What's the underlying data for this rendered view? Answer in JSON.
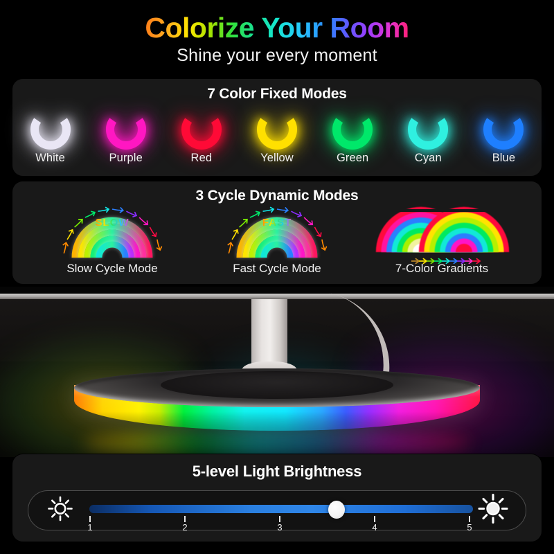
{
  "header": {
    "title": "Colorize Your Room",
    "subtitle": "Shine your every moment"
  },
  "fixed_modes": {
    "heading": "7 Color Fixed Modes",
    "items": [
      {
        "label": "White",
        "color": "#e9e6f5"
      },
      {
        "label": "Purple",
        "color": "#ff17c2"
      },
      {
        "label": "Red",
        "color": "#ff0a36"
      },
      {
        "label": "Yellow",
        "color": "#ffe000"
      },
      {
        "label": "Green",
        "color": "#00e86a"
      },
      {
        "label": "Cyan",
        "color": "#2ff0e0"
      },
      {
        "label": "Blue",
        "color": "#1e7fff"
      }
    ]
  },
  "cycle_modes": {
    "heading": "3 Cycle Dynamic Modes",
    "items": [
      {
        "label": "Slow Cycle Mode",
        "badge": "SLOW",
        "figure": "cycle-arc"
      },
      {
        "label": "Fast Cycle Mode",
        "badge": "FAST",
        "figure": "cycle-arc"
      },
      {
        "label": "7-Color Gradients",
        "badge": "",
        "figure": "gradient-arcs"
      }
    ]
  },
  "product_photo": {
    "alt": "RGB desk lamp base glowing with rainbow gradient",
    "base_gradient": [
      "#ff7b00",
      "#fff200",
      "#00f03c",
      "#12f2ee",
      "#2aa8ff",
      "#9a2dff",
      "#f21ee0",
      "#ff1040"
    ]
  },
  "brightness": {
    "heading": "5-level Light Brightness",
    "icon_low": "sun-small-icon",
    "icon_high": "sun-large-icon",
    "ticks": [
      "1",
      "2",
      "3",
      "4",
      "5"
    ],
    "current_level": 3.6,
    "track_color": "#2a7fe0",
    "thumb_color": "#ffffff"
  }
}
